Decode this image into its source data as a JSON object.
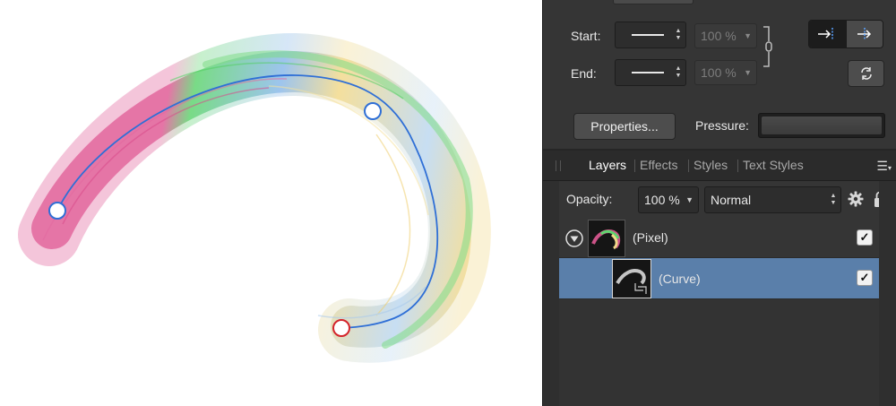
{
  "stroke_panel": {
    "start_label": "Start:",
    "end_label": "End:",
    "start_percent": "100 %",
    "end_percent": "100 %",
    "properties_button": "Properties...",
    "pressure_label": "Pressure:"
  },
  "layers_panel": {
    "tabs": [
      {
        "label": "Layers",
        "active": true
      },
      {
        "label": "Effects",
        "active": false
      },
      {
        "label": "Styles",
        "active": false
      },
      {
        "label": "Text Styles",
        "active": false
      }
    ],
    "opacity_label": "Opacity:",
    "opacity_value": "100 %",
    "blend_mode": "Normal",
    "layers": [
      {
        "name": "(Pixel)",
        "visible": true,
        "selected": false,
        "expanded": true
      },
      {
        "name": "(Curve)",
        "visible": true,
        "selected": true
      }
    ]
  },
  "colors": {
    "panel_bg": "#353535",
    "selection": "#5a7faa",
    "curve_line": "#2f6fd6",
    "end_node": "#d4242b",
    "brush_pink": "#e05a95",
    "brush_green": "#5fd46f",
    "brush_blue": "#8ab9ea",
    "brush_yellow": "#f2d98a"
  },
  "icons": [
    "chain-link-icon",
    "line-end-inside-icon",
    "line-end-outside-icon",
    "swap-icon",
    "grip-icon",
    "panel-menu-icon",
    "gear-icon",
    "lock-icon",
    "disclosure-icon",
    "checkmark-icon",
    "crop-icon"
  ]
}
